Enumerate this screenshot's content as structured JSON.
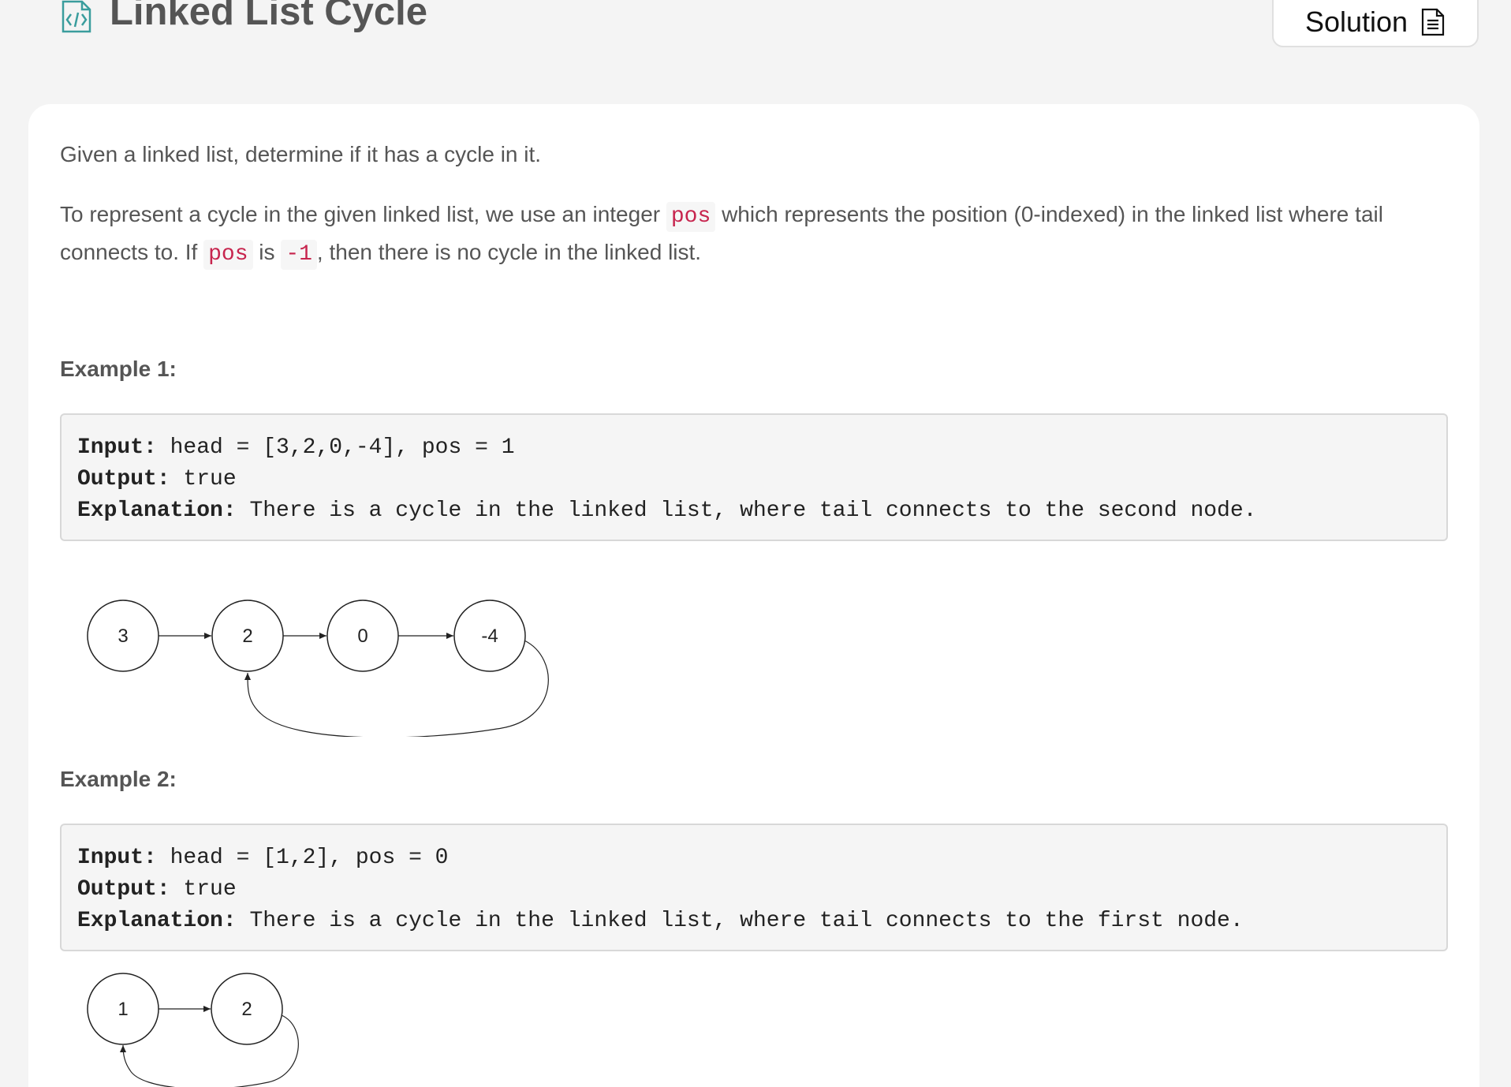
{
  "header": {
    "title": "Linked List Cycle",
    "solution_label": "Solution",
    "icon": "code-file-icon",
    "solution_icon": "document-icon"
  },
  "description": {
    "p1": "Given a linked list, determine if it has a cycle in it.",
    "p2_part1": "To represent a cycle in the given linked list, we use an integer ",
    "p2_code1": "pos",
    "p2_part2": " which represents the position (0-indexed) in the linked list where tail",
    "p2_part3": "connects to. If ",
    "p2_code2": "pos",
    "p2_part4": " is ",
    "p2_code3": "-1",
    "p2_part5": ", then there is no cycle in the linked list."
  },
  "examples": [
    {
      "title": "Example 1:",
      "input_label": "Input:",
      "input_value": " head = [3,2,0,-4], pos = 1",
      "output_label": "Output:",
      "output_value": " true",
      "explanation_label": "Explanation:",
      "explanation_value": " There is a cycle in the linked list, where tail connects to the second node.",
      "nodes": [
        "3",
        "2",
        "0",
        "-4"
      ]
    },
    {
      "title": "Example 2:",
      "input_label": "Input:",
      "input_value": " head = [1,2], pos = 0",
      "output_label": "Output:",
      "output_value": " true",
      "explanation_label": "Explanation:",
      "explanation_value": " There is a cycle in the linked list, where tail connects to the first node.",
      "nodes": [
        "1",
        "2"
      ]
    }
  ],
  "colors": {
    "background": "#f4f4f4",
    "card": "#ffffff",
    "code_bg": "#f5f5f5",
    "inline_code": "#c7254e",
    "icon_accent": "#3a9d9d"
  }
}
